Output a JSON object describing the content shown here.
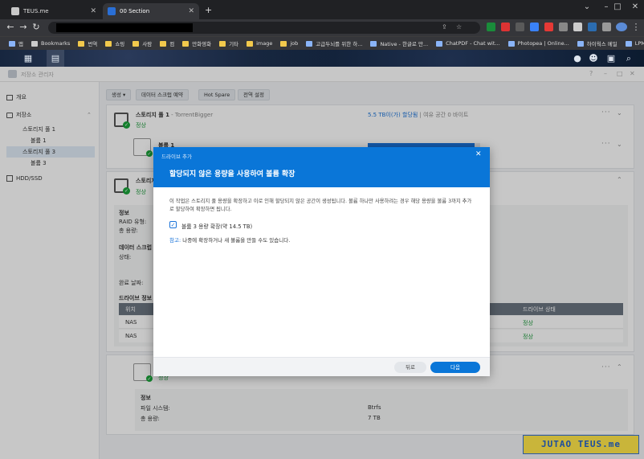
{
  "browser": {
    "tabs": [
      {
        "title": "TEUS.me",
        "active": false
      },
      {
        "title": "00 Section",
        "active": true
      }
    ],
    "new_tab": "+",
    "window_controls": [
      "⌄",
      "–",
      "□",
      "✕"
    ],
    "bookmarks": [
      {
        "label": "앱",
        "type": "apps"
      },
      {
        "label": "Bookmarks",
        "type": "star"
      },
      {
        "label": "번역",
        "type": "folder"
      },
      {
        "label": "쇼핑",
        "type": "folder"
      },
      {
        "label": "사람",
        "type": "folder"
      },
      {
        "label": "컴",
        "type": "folder"
      },
      {
        "label": "만화영화",
        "type": "folder"
      },
      {
        "label": "기타",
        "type": "folder"
      },
      {
        "label": "image",
        "type": "folder"
      },
      {
        "label": "job",
        "type": "folder"
      },
      {
        "label": "고급두뇌를 위한 하...",
        "type": "site"
      },
      {
        "label": "Native - 한글로 만...",
        "type": "site"
      },
      {
        "label": "ChatPDF - Chat wit...",
        "type": "site"
      },
      {
        "label": "Photopea | Online...",
        "type": "site"
      },
      {
        "label": "하이웍스 메일",
        "type": "site"
      },
      {
        "label": "LPMS",
        "type": "site"
      }
    ],
    "more": "»"
  },
  "app": {
    "title": "저장소 관리자",
    "title_controls": [
      "?",
      "–",
      "□",
      "✕"
    ]
  },
  "sidebar": {
    "items": [
      {
        "label": "개요",
        "level": 0,
        "icon": "overview-icon"
      },
      {
        "label": "저장소",
        "level": 0,
        "icon": "storage-icon"
      },
      {
        "label": "스토리지 풀 1",
        "level": 1
      },
      {
        "label": "볼륨 1",
        "level": 2
      },
      {
        "label": "스토리지 풀 3",
        "level": 1,
        "selected": true
      },
      {
        "label": "볼륨 3",
        "level": 2
      },
      {
        "label": "HDD/SSD",
        "level": 0,
        "icon": "disk-icon"
      }
    ]
  },
  "toolbar": {
    "create": "생성",
    "snapshot": "데이터 스크럽 예약",
    "hotspare": "Hot Spare",
    "global": "전역 설정"
  },
  "pool1": {
    "name": "스토리지 풀 1",
    "sub": " - TorrentBigger",
    "status": "정상",
    "usage_link": "5.5 TB이(가) 할당됨",
    "free": " | 여유 공간 0 바이트",
    "volume": {
      "name": "볼륨 1",
      "status": "정상",
      "fill_fraction": 0.95
    }
  },
  "pool3": {
    "name": "스토리지",
    "status": "정상",
    "info": {
      "header": "정보",
      "raid": "RAID 유형:",
      "total": "총 용량:",
      "scrub_header": "데이터 스크럽",
      "state": "상태:",
      "done": "완료 날짜:",
      "drive_info": "드라이브 정보"
    },
    "table": {
      "col_position": "위치",
      "col_status": "드라이브 상태",
      "rows": [
        {
          "location": "NAS",
          "status": "정상"
        },
        {
          "location": "NAS",
          "status": "정상"
        }
      ]
    }
  },
  "volume3": {
    "status": "정상",
    "info_header": "정보",
    "fs_label": "파일 시스템:",
    "fs_value": "Btrfs",
    "total_label": "총 용량:",
    "total_value": "7 TB"
  },
  "dialog": {
    "window_title": "드라이브 추가",
    "heading": "할당되지 않은 용량을 사용하여 볼륨 확장",
    "desc": "이 작업은 스토리지 풀 용량을 확장하고 이로 인해 할당되지 않은 공간이 생성됩니다. 볼륨 하나만 사용하려는 경우 해당 용량을 볼륨 3까지 추가로 할당하여 확장하면 됩니다.",
    "checkbox_label": "볼륨 3 용량 확장(약 14.5 TB)",
    "checkbox_checked": true,
    "note_label": "참고:",
    "note_text": " 나중에 확장하거나 새 볼륨을 만들 수도 있습니다.",
    "back": "뒤로",
    "next": "다음"
  },
  "watermark": "JUTAO TEUS.me"
}
